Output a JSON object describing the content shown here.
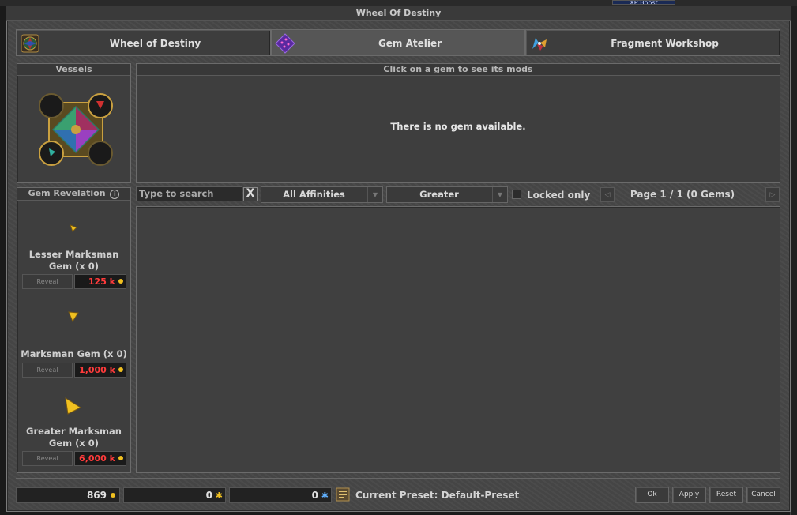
{
  "top_chip": "XP Boost",
  "window_title": "Wheel Of Destiny",
  "tabs": [
    {
      "label": "Wheel of Destiny",
      "icon": "wheel-icon",
      "active": false
    },
    {
      "label": "Gem Atelier",
      "icon": "gem-dice-icon",
      "active": true
    },
    {
      "label": "Fragment Workshop",
      "icon": "fragment-icon",
      "active": false
    }
  ],
  "vessels": {
    "title": "Vessels"
  },
  "mods_panel": {
    "title": "Click on a gem to see its mods",
    "empty_message": "There is no gem available."
  },
  "revelation": {
    "title": "Gem Revelation",
    "info_symbol": "i",
    "gems": [
      {
        "name": "Lesser Marksman Gem (x 0)",
        "reveal_label": "Reveal",
        "price": "125 k"
      },
      {
        "name": "Marksman Gem (x 0)",
        "reveal_label": "Reveal",
        "price": "1,000 k"
      },
      {
        "name": "Greater Marksman Gem (x 0)",
        "reveal_label": "Reveal",
        "price": "6,000 k"
      }
    ]
  },
  "filters": {
    "search_placeholder": "Type to search",
    "clear_symbol": "X",
    "affinity": "All Affinities",
    "grade": "Greater",
    "locked_only": "Locked only",
    "pagination": "Page 1 / 1 (0 Gems)"
  },
  "bottom": {
    "gold": "869",
    "fragments_lesser": "0",
    "fragments_greater": "0",
    "preset": "Current Preset: Default-Preset",
    "ok": "Ok",
    "apply": "Apply",
    "reset": "Reset",
    "cancel": "Cancel"
  },
  "colors": {
    "accent_gold": "#f0c020",
    "price_red": "#ff3b3b"
  }
}
